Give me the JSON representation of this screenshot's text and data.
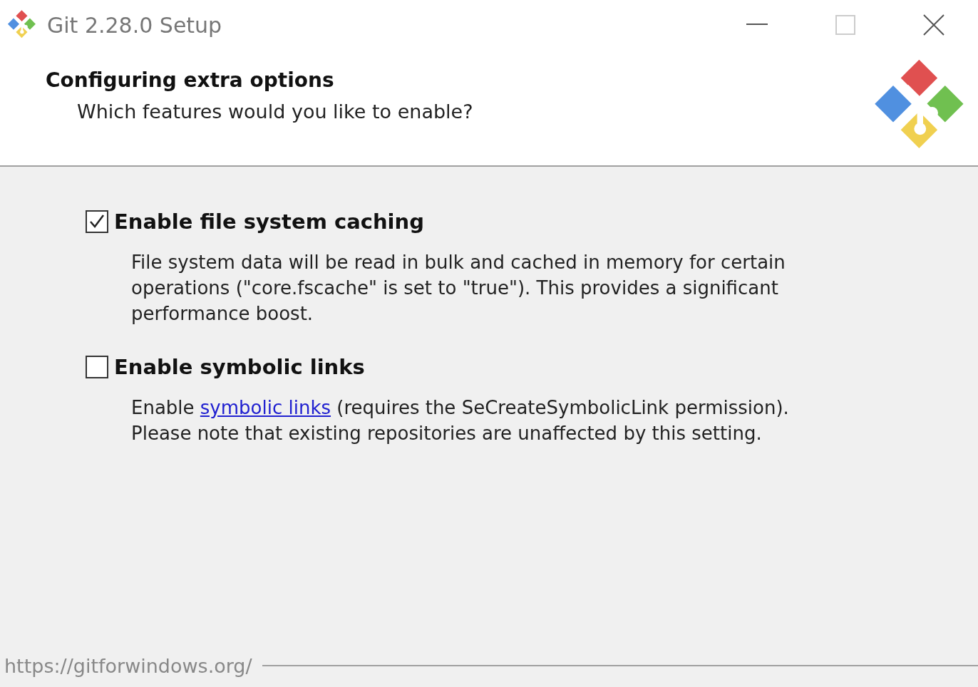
{
  "window": {
    "title": "Git 2.28.0 Setup"
  },
  "header": {
    "title": "Configuring extra options",
    "subtitle": "Which features would you like to enable?"
  },
  "options": [
    {
      "label": "Enable file system caching",
      "checked": true,
      "description": "File system data will be read in bulk and cached in memory for certain operations (\"core.fscache\" is set to \"true\"). This provides a significant performance boost."
    },
    {
      "label": "Enable symbolic links",
      "checked": false,
      "description": "Enable ",
      "link": "symbolic links",
      "description_after": " (requires the SeCreateSymbolicLink permission). Please note that existing repositories are unaffected by this setting."
    }
  ],
  "footer": {
    "url": "https://gitforwindows.org/"
  }
}
